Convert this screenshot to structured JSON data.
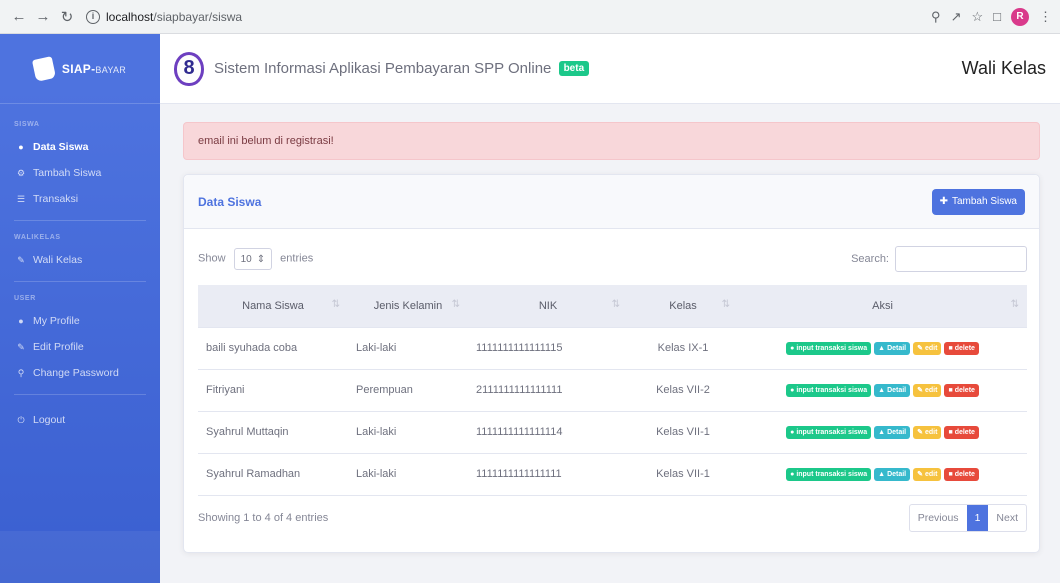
{
  "browser": {
    "url_host": "localhost",
    "url_path": "/siapbayar/siswa",
    "profile_initial": "R"
  },
  "sidebar": {
    "brand": "SIAP-",
    "brand_sub": "BAYAR",
    "sections": [
      {
        "heading": "SISWA",
        "items": [
          {
            "label": "Data Siswa",
            "icon": "user-icon",
            "active": true
          },
          {
            "label": "Tambah Siswa",
            "icon": "gear-icon",
            "active": false
          },
          {
            "label": "Transaksi",
            "icon": "list-icon",
            "active": false
          }
        ]
      },
      {
        "heading": "WALIKELAS",
        "items": [
          {
            "label": "Wali Kelas",
            "icon": "chat-icon",
            "active": false
          }
        ]
      },
      {
        "heading": "USER",
        "items": [
          {
            "label": "My Profile",
            "icon": "user-icon",
            "active": false
          },
          {
            "label": "Edit Profile",
            "icon": "user-edit-icon",
            "active": false
          },
          {
            "label": "Change Password",
            "icon": "key-icon",
            "active": false
          }
        ]
      }
    ],
    "logout": "Logout"
  },
  "topbar": {
    "title": "Sistem Informasi Aplikasi Pembayaran SPP Online",
    "badge": "beta",
    "user": "Wali Kelas"
  },
  "alert": {
    "message": "email ini belum di registrasi!"
  },
  "card": {
    "title": "Data Siswa",
    "add_button": "Tambah Siswa"
  },
  "controls": {
    "show_label": "Show",
    "entries_value": "10",
    "entries_label": "entries",
    "search_label": "Search:"
  },
  "table": {
    "headers": [
      "Nama Siswa",
      "Jenis Kelamin",
      "NIK",
      "Kelas",
      "Aksi"
    ],
    "rows": [
      {
        "nama": "baili syuhada coba",
        "jk": "Laki-laki",
        "nik": "1111111111111115",
        "kelas": "Kelas IX-1"
      },
      {
        "nama": "Fitriyani",
        "jk": "Perempuan",
        "nik": "2111111111111111",
        "kelas": "Kelas VII-2"
      },
      {
        "nama": "Syahrul Muttaqin",
        "jk": "Laki-laki",
        "nik": "1111111111111114",
        "kelas": "Kelas VII-1"
      },
      {
        "nama": "Syahrul Ramadhan",
        "jk": "Laki-laki",
        "nik": "1111111111111111",
        "kelas": "Kelas VII-1"
      }
    ],
    "actions": {
      "transaksi": "input transaksi siswa",
      "detail": "Detail",
      "edit": "edit",
      "delete": "delete"
    }
  },
  "footer": {
    "info": "Showing 1 to 4 of 4 entries",
    "prev": "Previous",
    "page": "1",
    "next": "Next"
  },
  "colors": {
    "primary": "#4e73df",
    "success": "#1cc88a",
    "info": "#36b9cc",
    "warning": "#f6c23e",
    "danger": "#e74a3b",
    "alert_bg": "#f8d7da"
  }
}
